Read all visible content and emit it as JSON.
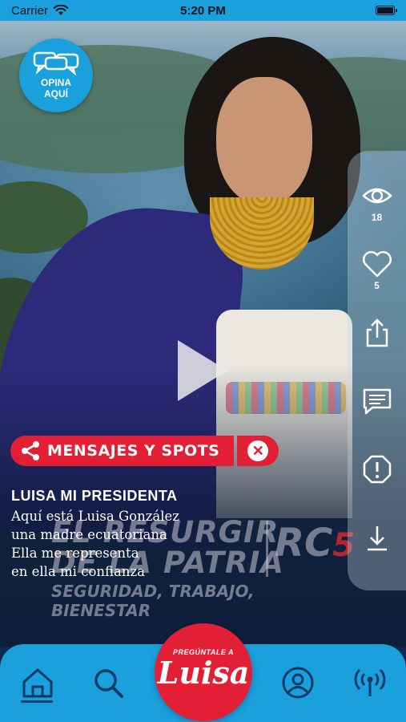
{
  "status_bar": {
    "carrier": "Carrier",
    "time": "5:20 PM"
  },
  "opina_button": {
    "label_line1": "OPINA",
    "label_line2": "AQUÍ"
  },
  "side_actions": {
    "views_count": "18",
    "likes_count": "5",
    "items": [
      "eye-icon",
      "heart-icon",
      "share-icon",
      "comment-icon",
      "report-icon",
      "download-icon"
    ]
  },
  "category_tag": {
    "label": "MENSAJES Y SPOTS",
    "close": "✕"
  },
  "caption": {
    "title": "LUISA MI PRESIDENTA",
    "lines": [
      "Aquí está Luisa González",
      "una madre ecuatoriana",
      "Ella me representa",
      "en ella mi confianza"
    ]
  },
  "watermark": {
    "line1": "EL RESURGIR",
    "line2": "DE LA PATRIA",
    "slogan": "SEGURIDAD, TRABAJO, BIENESTAR",
    "logo_letters": "RC",
    "logo_number": "5"
  },
  "bottom_nav": {
    "items": [
      "home",
      "search",
      "profile",
      "live"
    ],
    "center_button": {
      "subtitle": "PREGÚNTALE A",
      "name": "Luisa"
    }
  },
  "colors": {
    "accent_blue": "#1aa0dd",
    "accent_red": "#e21f35",
    "dark_navy": "#0d3b66"
  }
}
